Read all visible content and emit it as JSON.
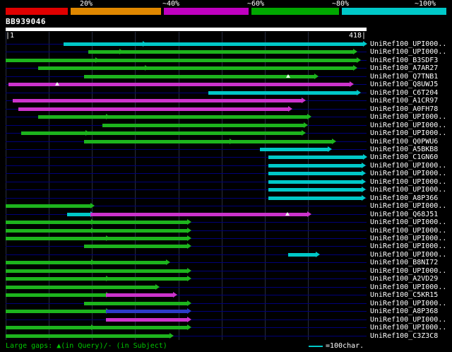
{
  "chart_data": {
    "type": "bar",
    "subtype": "sequence-alignment-overview",
    "title": "BB939046",
    "query": {
      "name": "BB939046",
      "start": 1,
      "end": 418,
      "ruler_left": "|1",
      "ruler_right": "418|"
    },
    "grid_interval": 50,
    "identity_key": [
      {
        "label": "20%",
        "color": "#e00000"
      },
      {
        "label": "~40%",
        "color": "#e08800"
      },
      {
        "label": "~60%",
        "color": "#c000c0"
      },
      {
        "label": "~80%",
        "color": "#00a800"
      },
      {
        "label": "~100%",
        "color": "#00c8c8"
      }
    ],
    "palette": {
      "cyan": "#00c8c8",
      "green": "#1db41d",
      "magenta": "#cc33cc",
      "blue": "#2d3cc8",
      "baseline": "#000078",
      "grid": "#272c40"
    },
    "legend": {
      "gaps": "Large gaps: ▲(in Query)/- (in Subject)",
      "scale": "=100char."
    },
    "rows": [
      {
        "label": "UniRef100_UPI000..",
        "segments": [
          {
            "s": 68,
            "e": 160,
            "c": "cyan"
          },
          {
            "s": 160,
            "e": 415,
            "c": "cyan"
          }
        ]
      },
      {
        "label": "UniRef100_UPI000..",
        "segments": [
          {
            "s": 97,
            "e": 133,
            "c": "green"
          },
          {
            "s": 133,
            "e": 403,
            "c": "green"
          }
        ]
      },
      {
        "label": "UniRef100_B3SDF3",
        "segments": [
          {
            "s": 1,
            "e": 105,
            "c": "green"
          },
          {
            "s": 105,
            "e": 407,
            "c": "green"
          }
        ]
      },
      {
        "label": "UniRef100_A7AR27",
        "segments": [
          {
            "s": 39,
            "e": 162,
            "c": "green"
          },
          {
            "s": 162,
            "e": 403,
            "c": "green"
          }
        ]
      },
      {
        "label": "UniRef100_Q7TNB1",
        "segments": [
          {
            "s": 92,
            "e": 358,
            "c": "green"
          }
        ],
        "gaps": [
          328
        ]
      },
      {
        "label": "UniRef100_Q8UWJ5",
        "segments": [
          {
            "s": 4,
            "e": 399,
            "c": "magenta"
          }
        ],
        "gaps": [
          61
        ]
      },
      {
        "label": "UniRef100_C6T204",
        "segments": [
          {
            "s": 236,
            "e": 407,
            "c": "cyan"
          }
        ]
      },
      {
        "label": "UniRef100_A1CR97",
        "segments": [
          {
            "s": 9,
            "e": 344,
            "c": "magenta"
          }
        ]
      },
      {
        "label": "UniRef100_A0FH78",
        "segments": [
          {
            "s": 16,
            "e": 328,
            "c": "magenta"
          }
        ]
      },
      {
        "label": "UniRef100_UPI000..",
        "segments": [
          {
            "s": 39,
            "e": 117,
            "c": "green"
          },
          {
            "s": 117,
            "e": 350,
            "c": "green"
          }
        ]
      },
      {
        "label": "UniRef100_UPI000..",
        "segments": [
          {
            "s": 113,
            "e": 346,
            "c": "green"
          }
        ]
      },
      {
        "label": "UniRef100_UPI000..",
        "segments": [
          {
            "s": 19,
            "e": 93,
            "c": "green"
          },
          {
            "s": 93,
            "e": 344,
            "c": "green"
          }
        ]
      },
      {
        "label": "UniRef100_Q0PWU6",
        "segments": [
          {
            "s": 92,
            "e": 260,
            "c": "green"
          },
          {
            "s": 260,
            "e": 379,
            "c": "green"
          }
        ]
      },
      {
        "label": "UniRef100_A5BKB8",
        "segments": [
          {
            "s": 295,
            "e": 374,
            "c": "cyan"
          }
        ]
      },
      {
        "label": "UniRef100_C1GN60",
        "segments": [
          {
            "s": 305,
            "e": 415,
            "c": "cyan"
          }
        ]
      },
      {
        "label": "UniRef100_UPI000..",
        "segments": [
          {
            "s": 305,
            "e": 413,
            "c": "cyan"
          }
        ]
      },
      {
        "label": "UniRef100_UPI000..",
        "segments": [
          {
            "s": 305,
            "e": 413,
            "c": "cyan"
          }
        ]
      },
      {
        "label": "UniRef100_UPI000..",
        "segments": [
          {
            "s": 305,
            "e": 413,
            "c": "cyan"
          }
        ]
      },
      {
        "label": "UniRef100_UPI000..",
        "segments": [
          {
            "s": 305,
            "e": 413,
            "c": "cyan"
          }
        ]
      },
      {
        "label": "UniRef100_A8P366",
        "segments": [
          {
            "s": 305,
            "e": 413,
            "c": "cyan"
          }
        ]
      },
      {
        "label": "UniRef100_UPI000..",
        "segments": [
          {
            "s": 1,
            "e": 99,
            "c": "green"
          }
        ]
      },
      {
        "label": "UniRef100_Q68J51",
        "segments": [
          {
            "s": 72,
            "e": 99,
            "c": "cyan"
          },
          {
            "s": 99,
            "e": 350,
            "c": "magenta"
          }
        ],
        "gaps": [
          327
        ]
      },
      {
        "label": "UniRef100_UPI000..",
        "segments": [
          {
            "s": 1,
            "e": 100,
            "c": "green"
          },
          {
            "s": 100,
            "e": 211,
            "c": "green"
          }
        ]
      },
      {
        "label": "UniRef100_UPI000..",
        "segments": [
          {
            "s": 1,
            "e": 100,
            "c": "green"
          },
          {
            "s": 100,
            "e": 211,
            "c": "green"
          }
        ]
      },
      {
        "label": "UniRef100_UPI000..",
        "segments": [
          {
            "s": 1,
            "e": 117,
            "c": "green"
          },
          {
            "s": 117,
            "e": 211,
            "c": "green"
          }
        ]
      },
      {
        "label": "UniRef100_UPI000..",
        "segments": [
          {
            "s": 92,
            "e": 211,
            "c": "green"
          }
        ]
      },
      {
        "label": "UniRef100_UPI000..",
        "segments": [
          {
            "s": 328,
            "e": 360,
            "c": "cyan"
          }
        ]
      },
      {
        "label": "UniRef100_B8NI72",
        "segments": [
          {
            "s": 1,
            "e": 100,
            "c": "green"
          },
          {
            "s": 100,
            "e": 187,
            "c": "green"
          }
        ]
      },
      {
        "label": "UniRef100_UPI000..",
        "segments": [
          {
            "s": 1,
            "e": 211,
            "c": "green"
          }
        ]
      },
      {
        "label": "UniRef100_A2VD29",
        "segments": [
          {
            "s": 1,
            "e": 117,
            "c": "green"
          },
          {
            "s": 117,
            "e": 211,
            "c": "green"
          }
        ]
      },
      {
        "label": "UniRef100_UPI000..",
        "segments": [
          {
            "s": 1,
            "e": 174,
            "c": "green"
          }
        ]
      },
      {
        "label": "UniRef100_C5KR15",
        "segments": [
          {
            "s": 1,
            "e": 117,
            "c": "green"
          },
          {
            "s": 117,
            "e": 195,
            "c": "magenta"
          }
        ]
      },
      {
        "label": "UniRef100_UPI000..",
        "segments": [
          {
            "s": 92,
            "e": 211,
            "c": "green"
          }
        ]
      },
      {
        "label": "UniRef100_A8P368",
        "segments": [
          {
            "s": 1,
            "e": 117,
            "c": "green"
          },
          {
            "s": 117,
            "e": 211,
            "c": "blue"
          }
        ]
      },
      {
        "label": "UniRef100_UPI000..",
        "segments": [
          {
            "s": 117,
            "e": 211,
            "c": "magenta"
          }
        ]
      },
      {
        "label": "UniRef100_UPI000..",
        "segments": [
          {
            "s": 1,
            "e": 100,
            "c": "green"
          },
          {
            "s": 100,
            "e": 211,
            "c": "green"
          }
        ]
      },
      {
        "label": "UniRef100_C3Z3C8",
        "segments": [
          {
            "s": 1,
            "e": 191,
            "c": "green"
          }
        ]
      }
    ]
  }
}
